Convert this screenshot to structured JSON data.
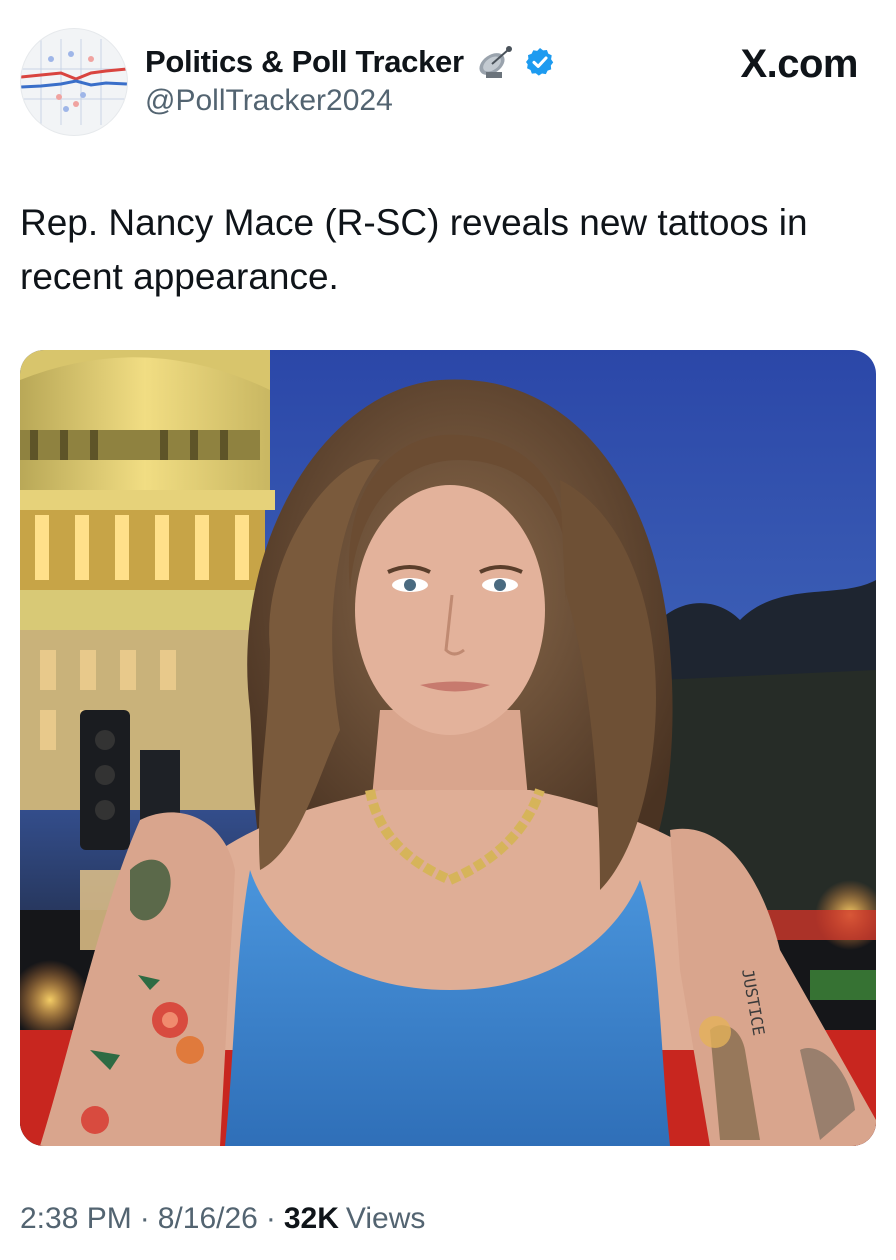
{
  "account": {
    "display_name": "Politics & Poll Tracker",
    "handle": "@PollTracker2024",
    "badges": [
      "satellite-dish-icon",
      "verified-badge-icon"
    ],
    "verified_color": "#1d9bf0"
  },
  "site": "X.com",
  "tweet": {
    "text": "Rep. Nancy Mace (R-SC) reveals new tattoos in recent appearance.",
    "media": {
      "description_icons": [
        "capitol-dome",
        "portrait"
      ],
      "arm_tattoo_text": "JUSTICE"
    }
  },
  "meta": {
    "time": "2:38 PM",
    "date": "8/16/26",
    "separator": "·",
    "views_count": "32K",
    "views_label": "Views"
  },
  "colors": {
    "text_primary": "#0f1419",
    "text_secondary": "#536471",
    "dress": "#3f86cf",
    "sky": "#2f4f9e"
  }
}
